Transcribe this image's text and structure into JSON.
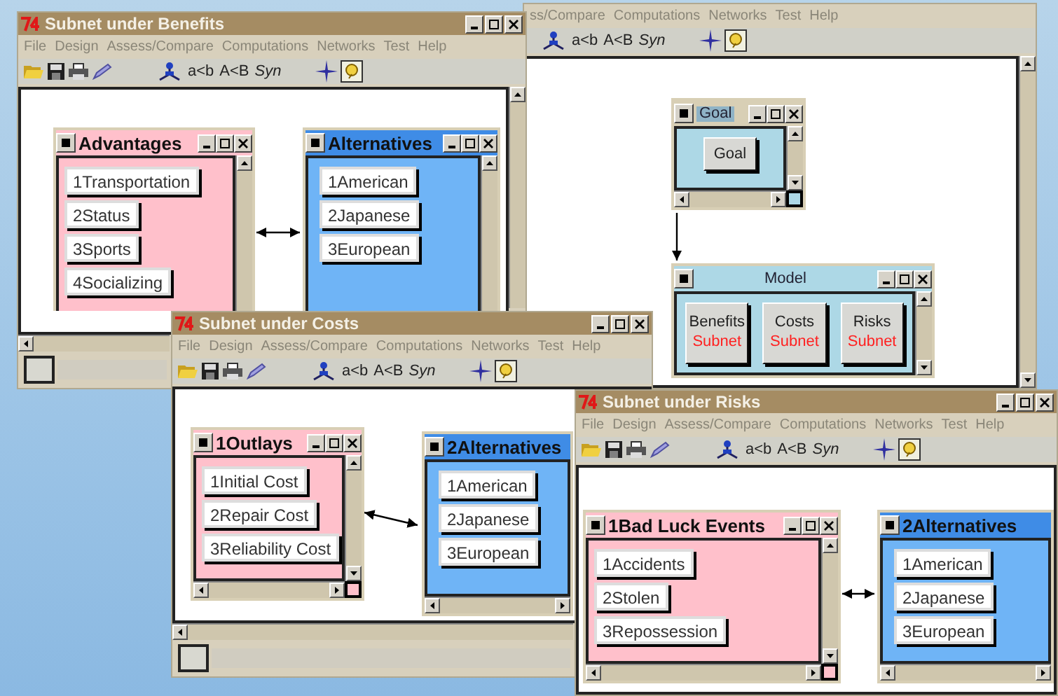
{
  "windows": [
    {
      "kind": "main",
      "menu": [
        "ss/Compare",
        "Computations",
        "Networks",
        "Test",
        "Help"
      ],
      "toolbar_labels": [
        "a<b",
        "A<B",
        "Syn"
      ],
      "clusters": [
        {
          "kind": "goal",
          "title": "Goal",
          "color": "#add8e6",
          "items": [
            {
              "label": "Goal"
            }
          ]
        },
        {
          "kind": "model",
          "title": "Model",
          "color": "#add8e6",
          "items": [
            {
              "label": "Benefits",
              "sublabel": "Subnet"
            },
            {
              "label": "Costs",
              "sublabel": "Subnet"
            },
            {
              "label": "Risks",
              "sublabel": "Subnet"
            }
          ]
        }
      ]
    },
    {
      "kind": "subnet",
      "title": "Subnet under Benefits",
      "menu": [
        "File",
        "Design",
        "Assess/Compare",
        "Computations",
        "Networks",
        "Test",
        "Help"
      ],
      "toolbar_labels": [
        "a<b",
        "A<B",
        "Syn"
      ],
      "clusters": [
        {
          "kind": "criteria",
          "title": "Advantages",
          "color": "#ffc0cb",
          "items": [
            {
              "label": "1Transportation"
            },
            {
              "label": "2Status"
            },
            {
              "label": "3Sports"
            },
            {
              "label": "4Socializing"
            }
          ]
        },
        {
          "kind": "alternatives",
          "title": "Alternatives",
          "color": "#6fb4f6",
          "items": [
            {
              "label": "1American"
            },
            {
              "label": "2Japanese"
            },
            {
              "label": "3European"
            }
          ]
        }
      ]
    },
    {
      "kind": "subnet",
      "title": "Subnet under Costs",
      "menu": [
        "File",
        "Design",
        "Assess/Compare",
        "Computations",
        "Networks",
        "Test",
        "Help"
      ],
      "toolbar_labels": [
        "a<b",
        "A<B",
        "Syn"
      ],
      "clusters": [
        {
          "kind": "criteria",
          "title": "1Outlays",
          "color": "#ffc0cb",
          "items": [
            {
              "label": "1Initial Cost"
            },
            {
              "label": "2Repair Cost"
            },
            {
              "label": "3Reliability Cost"
            }
          ]
        },
        {
          "kind": "alternatives",
          "title": "2Alternatives",
          "color": "#6fb4f6",
          "items": [
            {
              "label": "1American"
            },
            {
              "label": "2Japanese"
            },
            {
              "label": "3European"
            }
          ]
        }
      ]
    },
    {
      "kind": "subnet",
      "title": "Subnet under Risks",
      "menu": [
        "File",
        "Design",
        "Assess/Compare",
        "Computations",
        "Networks",
        "Test",
        "Help"
      ],
      "toolbar_labels": [
        "a<b",
        "A<B",
        "Syn"
      ],
      "clusters": [
        {
          "kind": "criteria",
          "title": "1Bad Luck Events",
          "color": "#ffc0cb",
          "items": [
            {
              "label": "1Accidents"
            },
            {
              "label": "2Stolen"
            },
            {
              "label": "3Repossession"
            }
          ]
        },
        {
          "kind": "alternatives",
          "title": "2Alternatives",
          "color": "#6fb4f6",
          "items": [
            {
              "label": "1American"
            },
            {
              "label": "2Japanese"
            },
            {
              "label": "3European"
            }
          ]
        }
      ]
    }
  ]
}
